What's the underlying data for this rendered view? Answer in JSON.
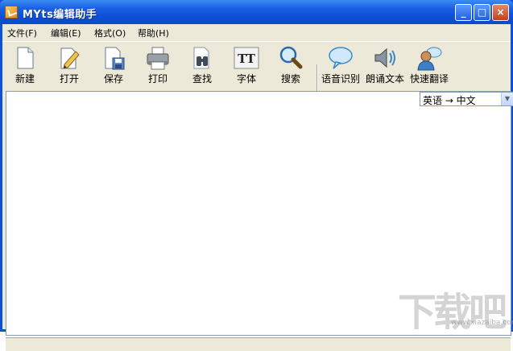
{
  "window": {
    "title": "MYts编辑助手",
    "min_glyph": "_",
    "max_glyph": "□",
    "close_glyph": "×"
  },
  "menu": {
    "items": [
      {
        "label": "文件(F)"
      },
      {
        "label": "编辑(E)"
      },
      {
        "label": "格式(O)"
      },
      {
        "label": "帮助(H)"
      }
    ]
  },
  "toolbar": {
    "tools": [
      {
        "label": "新建",
        "icon": "new-document-icon"
      },
      {
        "label": "打开",
        "icon": "open-edit-icon"
      },
      {
        "label": "保存",
        "icon": "save-icon"
      },
      {
        "label": "打印",
        "icon": "printer-icon"
      },
      {
        "label": "查找",
        "icon": "binoculars-icon"
      },
      {
        "label": "字体",
        "icon": "font-icon"
      },
      {
        "label": "搜索",
        "icon": "magnifier-icon"
      },
      {
        "label": "语音识别",
        "icon": "speech-bubble-icon"
      },
      {
        "label": "朗诵文本",
        "icon": "speaker-icon"
      },
      {
        "label": "快速翻译",
        "icon": "user-chat-icon"
      }
    ]
  },
  "editor": {
    "language_selection": "英语 → 中文"
  },
  "watermark": {
    "text": "下载吧",
    "url": "www.xiazaiba.com"
  }
}
